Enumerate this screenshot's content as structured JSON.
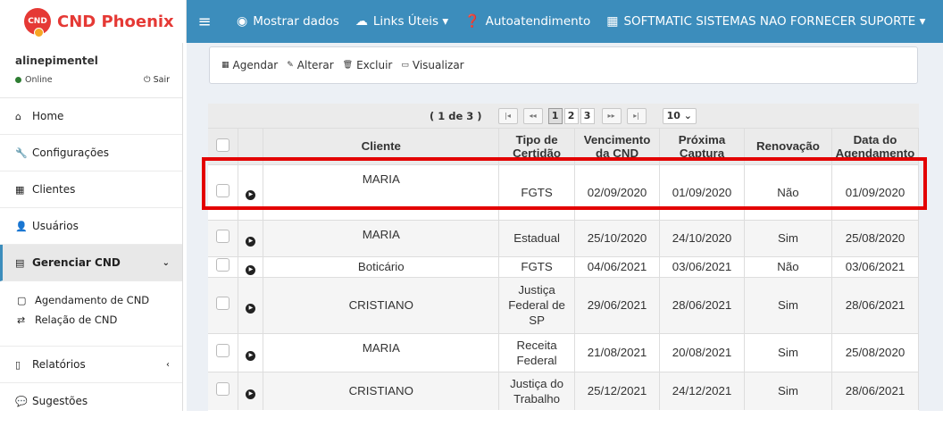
{
  "brand": {
    "badge": "CND",
    "name": "CND Phoenix"
  },
  "topnav": {
    "menu_icon": "hamburger-icon",
    "items": [
      {
        "label": "Mostrar dados",
        "icon": "eye-icon"
      },
      {
        "label": "Links Úteis ▾",
        "icon": "cloud-icon"
      },
      {
        "label": "Autoatendimento",
        "icon": "question-circle-icon"
      },
      {
        "label": "SOFTMATIC SISTEMAS NAO FORNECER SUPORTE ▾",
        "icon": "building-icon"
      }
    ]
  },
  "user": {
    "name": "alinepimentel",
    "status": "Online",
    "logout": "Sair"
  },
  "sidebar": {
    "items": [
      {
        "label": "Home",
        "icon": "home-icon"
      },
      {
        "label": "Configurações",
        "icon": "wrench-icon"
      },
      {
        "label": "Clientes",
        "icon": "building-icon"
      },
      {
        "label": "Usuários",
        "icon": "user-icon"
      },
      {
        "label": "Gerenciar CND",
        "icon": "calendar-icon",
        "active": true
      },
      {
        "label": "Relatórios",
        "icon": "file-icon"
      },
      {
        "label": "Sugestões",
        "icon": "comments-icon"
      }
    ],
    "submenu": [
      {
        "label": "Agendamento de CND",
        "icon": "calendar-icon"
      },
      {
        "label": "Relação de CND",
        "icon": "retweet-icon"
      }
    ],
    "chev_down": "⌄",
    "chev_left": "‹"
  },
  "toolbar": {
    "agendar": "Agendar",
    "alterar": "Alterar",
    "excluir": "Excluir",
    "visualizar": "Visualizar"
  },
  "pager": {
    "info": "( 1 de 3 )",
    "pages": [
      "1",
      "2",
      "3"
    ],
    "per_page": "10 ⌄"
  },
  "table": {
    "headers": [
      "Cliente",
      "Tipo de Certidão",
      "Vencimento da CND",
      "Próxima Captura",
      "Renovação",
      "Data do Agendamento"
    ],
    "rows": [
      {
        "cliente": "MARIA",
        "tipo": "FGTS",
        "vencimento": "02/09/2020",
        "proxima": "01/09/2020",
        "renovacao": "Não",
        "agendamento": "01/09/2020"
      },
      {
        "cliente": "MARIA",
        "tipo": "Estadual",
        "vencimento": "25/10/2020",
        "proxima": "24/10/2020",
        "renovacao": "Sim",
        "agendamento": "25/08/2020"
      },
      {
        "cliente": "Boticário",
        "tipo": "FGTS",
        "vencimento": "04/06/2021",
        "proxima": "03/06/2021",
        "renovacao": "Não",
        "agendamento": "03/06/2021"
      },
      {
        "cliente": "CRISTIANO",
        "tipo": "Justiça Federal de SP",
        "vencimento": "29/06/2021",
        "proxima": "28/06/2021",
        "renovacao": "Sim",
        "agendamento": "28/06/2021"
      },
      {
        "cliente": "MARIA",
        "tipo": "Receita Federal",
        "vencimento": "21/08/2021",
        "proxima": "20/08/2021",
        "renovacao": "Sim",
        "agendamento": "25/08/2020"
      },
      {
        "cliente": "CRISTIANO",
        "tipo": "Justiça do Trabalho",
        "vencimento": "25/12/2021",
        "proxima": "24/12/2021",
        "renovacao": "Sim",
        "agendamento": "28/06/2021"
      }
    ]
  }
}
